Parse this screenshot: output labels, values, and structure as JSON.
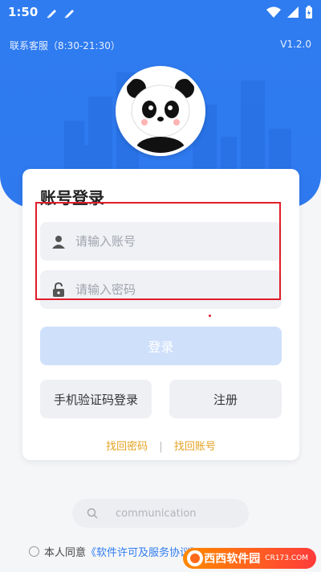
{
  "status": {
    "time": "1:50"
  },
  "top": {
    "service": "联系客服（8:30-21:30）",
    "version": "V1.2.0"
  },
  "card": {
    "title": "账号登录",
    "account_placeholder": "请输入账号",
    "password_placeholder": "请输入密码",
    "login_label": "登录",
    "sms_login_label": "手机验证码登录",
    "register_label": "注册",
    "find_password": "找回密码",
    "separator": "|",
    "find_account": "找回账号"
  },
  "search": {
    "placeholder": "communication"
  },
  "agreement": {
    "prefix": "本人同意",
    "policy": "《软件许可及服务协议》"
  },
  "watermark": {
    "brand": "西西软件园",
    "url": "CR173.COM"
  },
  "colors": {
    "primary": "#2f7cf0",
    "link": "#e6a221",
    "highlight": "#e01e2a"
  }
}
